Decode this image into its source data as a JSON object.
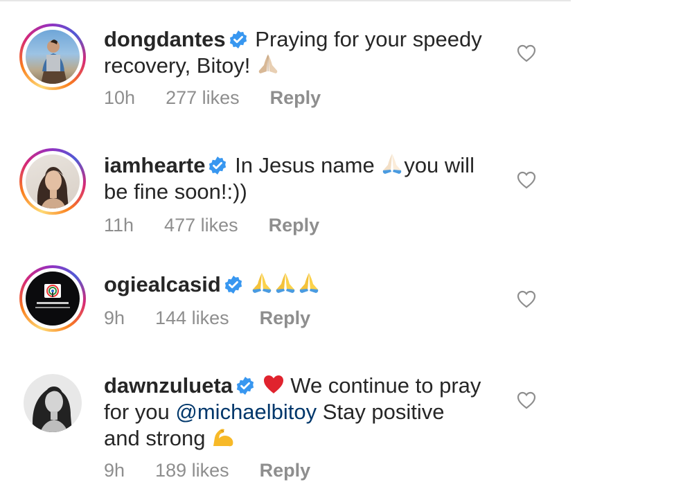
{
  "comments": [
    {
      "username": "dongdantes",
      "pre_text": "Praying for your speedy",
      "line2": "recovery, Bitoy! ",
      "time": "10h",
      "likes": "277 likes",
      "reply": "Reply"
    },
    {
      "username": "iamhearte",
      "pre_text": "In Jesus name ",
      "post_text": "you will",
      "line2": "be fine soon!:))",
      "time": "11h",
      "likes": "477 likes",
      "reply": "Reply"
    },
    {
      "username": "ogiealcasid",
      "time": "9h",
      "likes": "144 likes",
      "reply": "Reply"
    },
    {
      "username": "dawnzulueta",
      "pre_text": " We continue to pray",
      "line2_a": "for you ",
      "mention": "@michaelbitoy",
      "line2_b": " Stay positive",
      "line3": "and strong ",
      "time": "9h",
      "likes": "189 likes",
      "reply": "Reply"
    }
  ],
  "colors": {
    "text": "#262626",
    "meta": "#8e8e8e",
    "verified": "#3897f0",
    "mention": "#00376b",
    "heart_red": "#e0232e"
  },
  "icons": [
    "verified-badge-icon",
    "folded-hands-icon",
    "red-heart-icon",
    "flexed-biceps-icon",
    "like-heart-icon"
  ]
}
